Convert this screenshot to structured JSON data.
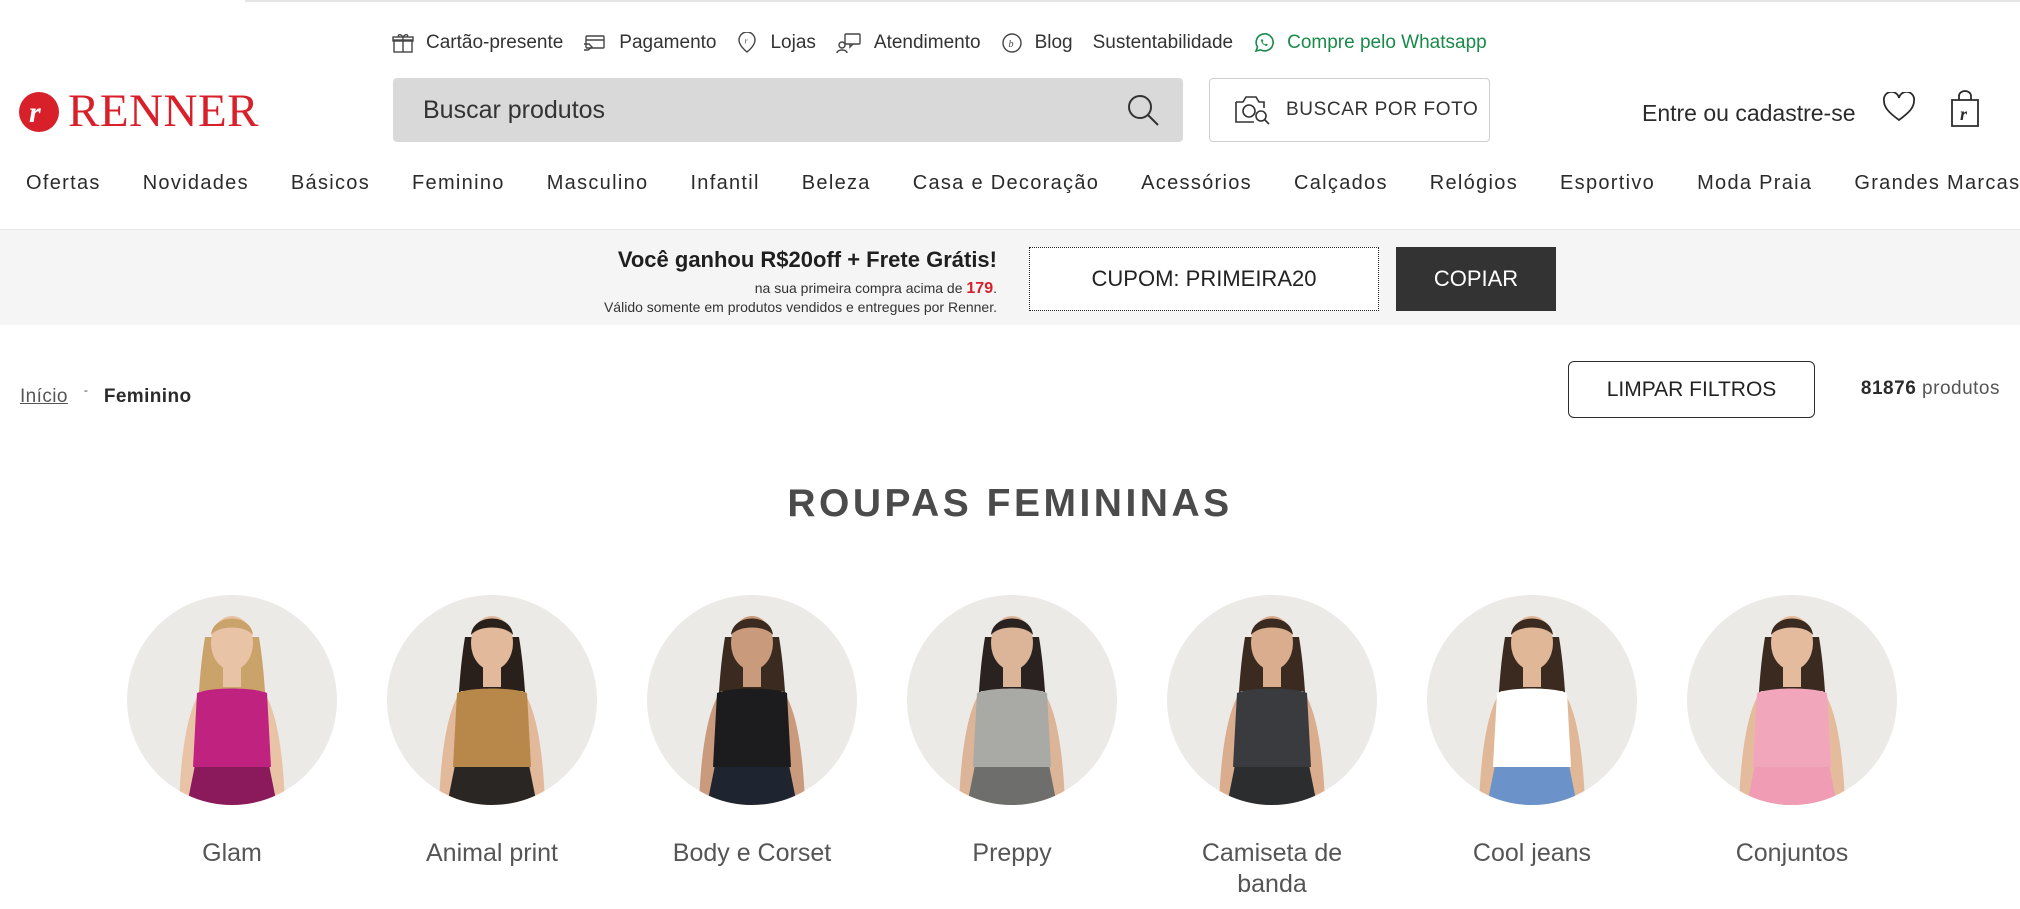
{
  "utility": {
    "gift": "Cartão-presente",
    "payment": "Pagamento",
    "stores": "Lojas",
    "support": "Atendimento",
    "blog": "Blog",
    "sustainability": "Sustentabilidade",
    "whatsapp": "Compre pelo Whatsapp"
  },
  "header": {
    "logo": "RENNER",
    "search_placeholder": "Buscar produtos",
    "photo_search": "BUSCAR POR FOTO",
    "login": "Entre ou cadastre-se"
  },
  "nav": [
    "Ofertas",
    "Novidades",
    "Básicos",
    "Feminino",
    "Masculino",
    "Infantil",
    "Beleza",
    "Casa e Decoração",
    "Acessórios",
    "Calçados",
    "Relógios",
    "Esportivo",
    "Moda Praia",
    "Grandes Marcas"
  ],
  "promo": {
    "title": "Você ganhou R$20off + Frete Grátis!",
    "line1_prefix": "na sua primeira compra acima de ",
    "line1_price": "179",
    "line1_suffix": ".",
    "line2": "Válido somente em produtos vendidos e entregues por Renner.",
    "coupon": "CUPOM: PRIMEIRA20",
    "copy": "COPIAR"
  },
  "breadcrumb": {
    "home": "Início",
    "separator": "-",
    "current": "Feminino"
  },
  "filters": {
    "clear": "LIMPAR FILTROS",
    "count": "81876",
    "count_label": " produtos"
  },
  "page_title": "ROUPAS FEMININAS",
  "categories": [
    {
      "label": "Glam",
      "colors": {
        "top": "#c0237f",
        "bottom": "#8a1a5c",
        "skin": "#e9c3a5",
        "hair": "#c9a36a"
      }
    },
    {
      "label": "Animal print",
      "colors": {
        "top": "#b8874a",
        "bottom": "#2a2624",
        "skin": "#e2b99a",
        "hair": "#2a201b"
      }
    },
    {
      "label": "Body e Corset",
      "colors": {
        "top": "#1c1c1e",
        "bottom": "#1e2430",
        "skin": "#c99a7c",
        "hair": "#3a2a20"
      }
    },
    {
      "label": "Preppy",
      "colors": {
        "top": "#a9a9a6",
        "bottom": "#6e6e6c",
        "skin": "#dcb497",
        "hair": "#2a2220"
      }
    },
    {
      "label": "Camiseta de banda",
      "colors": {
        "top": "#3a3b3e",
        "bottom": "#2c2d2f",
        "skin": "#d9ad8d",
        "hair": "#3b2a1f"
      }
    },
    {
      "label": "Cool jeans",
      "colors": {
        "top": "#ffffff",
        "bottom": "#6b93c9",
        "skin": "#e0b898",
        "hair": "#3b2a1f"
      }
    },
    {
      "label": "Conjuntos",
      "colors": {
        "top": "#f2a6bc",
        "bottom": "#ef9cb4",
        "skin": "#e4bb9c",
        "hair": "#3b2a1f"
      }
    }
  ]
}
